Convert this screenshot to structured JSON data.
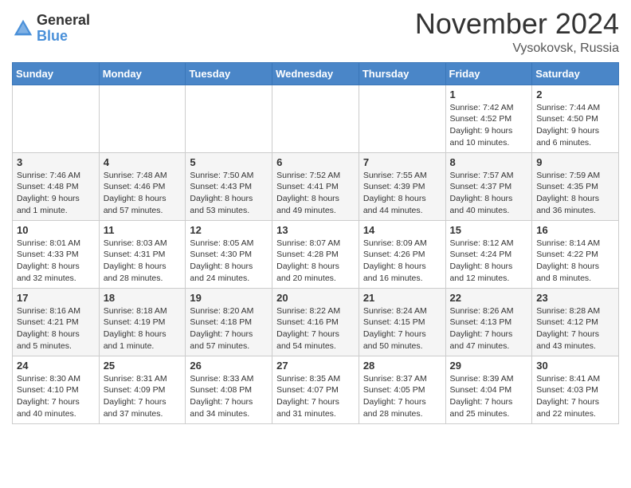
{
  "logo": {
    "general": "General",
    "blue": "Blue"
  },
  "header": {
    "month": "November 2024",
    "location": "Vysokovsk, Russia"
  },
  "weekdays": [
    "Sunday",
    "Monday",
    "Tuesday",
    "Wednesday",
    "Thursday",
    "Friday",
    "Saturday"
  ],
  "weeks": [
    [
      {
        "day": "",
        "info": ""
      },
      {
        "day": "",
        "info": ""
      },
      {
        "day": "",
        "info": ""
      },
      {
        "day": "",
        "info": ""
      },
      {
        "day": "",
        "info": ""
      },
      {
        "day": "1",
        "info": "Sunrise: 7:42 AM\nSunset: 4:52 PM\nDaylight: 9 hours\nand 10 minutes."
      },
      {
        "day": "2",
        "info": "Sunrise: 7:44 AM\nSunset: 4:50 PM\nDaylight: 9 hours\nand 6 minutes."
      }
    ],
    [
      {
        "day": "3",
        "info": "Sunrise: 7:46 AM\nSunset: 4:48 PM\nDaylight: 9 hours\nand 1 minute."
      },
      {
        "day": "4",
        "info": "Sunrise: 7:48 AM\nSunset: 4:46 PM\nDaylight: 8 hours\nand 57 minutes."
      },
      {
        "day": "5",
        "info": "Sunrise: 7:50 AM\nSunset: 4:43 PM\nDaylight: 8 hours\nand 53 minutes."
      },
      {
        "day": "6",
        "info": "Sunrise: 7:52 AM\nSunset: 4:41 PM\nDaylight: 8 hours\nand 49 minutes."
      },
      {
        "day": "7",
        "info": "Sunrise: 7:55 AM\nSunset: 4:39 PM\nDaylight: 8 hours\nand 44 minutes."
      },
      {
        "day": "8",
        "info": "Sunrise: 7:57 AM\nSunset: 4:37 PM\nDaylight: 8 hours\nand 40 minutes."
      },
      {
        "day": "9",
        "info": "Sunrise: 7:59 AM\nSunset: 4:35 PM\nDaylight: 8 hours\nand 36 minutes."
      }
    ],
    [
      {
        "day": "10",
        "info": "Sunrise: 8:01 AM\nSunset: 4:33 PM\nDaylight: 8 hours\nand 32 minutes."
      },
      {
        "day": "11",
        "info": "Sunrise: 8:03 AM\nSunset: 4:31 PM\nDaylight: 8 hours\nand 28 minutes."
      },
      {
        "day": "12",
        "info": "Sunrise: 8:05 AM\nSunset: 4:30 PM\nDaylight: 8 hours\nand 24 minutes."
      },
      {
        "day": "13",
        "info": "Sunrise: 8:07 AM\nSunset: 4:28 PM\nDaylight: 8 hours\nand 20 minutes."
      },
      {
        "day": "14",
        "info": "Sunrise: 8:09 AM\nSunset: 4:26 PM\nDaylight: 8 hours\nand 16 minutes."
      },
      {
        "day": "15",
        "info": "Sunrise: 8:12 AM\nSunset: 4:24 PM\nDaylight: 8 hours\nand 12 minutes."
      },
      {
        "day": "16",
        "info": "Sunrise: 8:14 AM\nSunset: 4:22 PM\nDaylight: 8 hours\nand 8 minutes."
      }
    ],
    [
      {
        "day": "17",
        "info": "Sunrise: 8:16 AM\nSunset: 4:21 PM\nDaylight: 8 hours\nand 5 minutes."
      },
      {
        "day": "18",
        "info": "Sunrise: 8:18 AM\nSunset: 4:19 PM\nDaylight: 8 hours\nand 1 minute."
      },
      {
        "day": "19",
        "info": "Sunrise: 8:20 AM\nSunset: 4:18 PM\nDaylight: 7 hours\nand 57 minutes."
      },
      {
        "day": "20",
        "info": "Sunrise: 8:22 AM\nSunset: 4:16 PM\nDaylight: 7 hours\nand 54 minutes."
      },
      {
        "day": "21",
        "info": "Sunrise: 8:24 AM\nSunset: 4:15 PM\nDaylight: 7 hours\nand 50 minutes."
      },
      {
        "day": "22",
        "info": "Sunrise: 8:26 AM\nSunset: 4:13 PM\nDaylight: 7 hours\nand 47 minutes."
      },
      {
        "day": "23",
        "info": "Sunrise: 8:28 AM\nSunset: 4:12 PM\nDaylight: 7 hours\nand 43 minutes."
      }
    ],
    [
      {
        "day": "24",
        "info": "Sunrise: 8:30 AM\nSunset: 4:10 PM\nDaylight: 7 hours\nand 40 minutes."
      },
      {
        "day": "25",
        "info": "Sunrise: 8:31 AM\nSunset: 4:09 PM\nDaylight: 7 hours\nand 37 minutes."
      },
      {
        "day": "26",
        "info": "Sunrise: 8:33 AM\nSunset: 4:08 PM\nDaylight: 7 hours\nand 34 minutes."
      },
      {
        "day": "27",
        "info": "Sunrise: 8:35 AM\nSunset: 4:07 PM\nDaylight: 7 hours\nand 31 minutes."
      },
      {
        "day": "28",
        "info": "Sunrise: 8:37 AM\nSunset: 4:05 PM\nDaylight: 7 hours\nand 28 minutes."
      },
      {
        "day": "29",
        "info": "Sunrise: 8:39 AM\nSunset: 4:04 PM\nDaylight: 7 hours\nand 25 minutes."
      },
      {
        "day": "30",
        "info": "Sunrise: 8:41 AM\nSunset: 4:03 PM\nDaylight: 7 hours\nand 22 minutes."
      }
    ]
  ]
}
